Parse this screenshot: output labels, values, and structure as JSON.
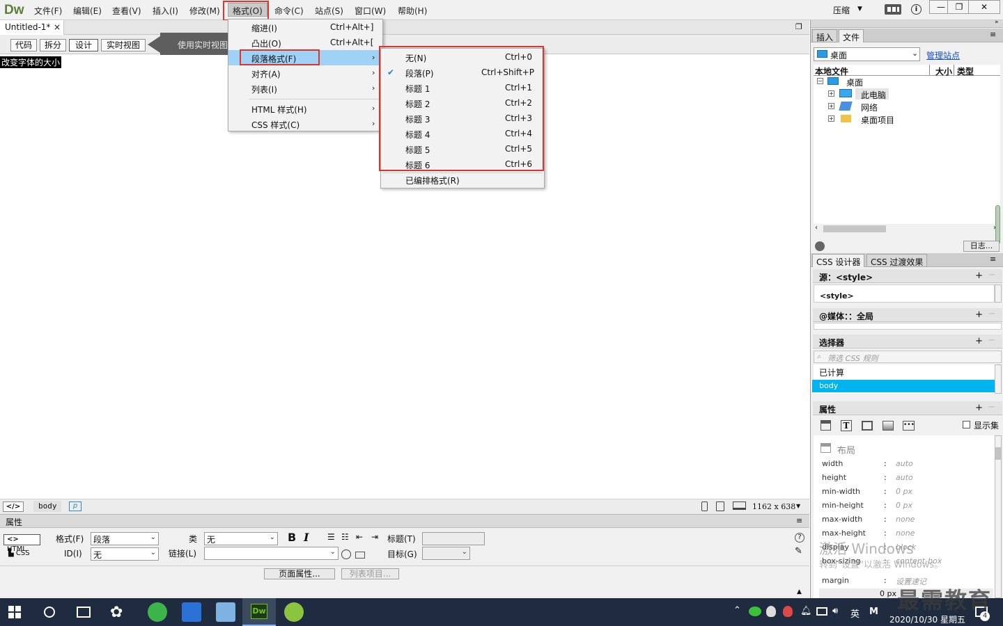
{
  "app": {
    "logo": "Dw"
  },
  "menubar": {
    "items": [
      "文件(F)",
      "编辑(E)",
      "查看(V)",
      "插入(I)",
      "修改(M)",
      "格式(O)",
      "命令(C)",
      "站点(S)",
      "窗口(W)",
      "帮助(H)"
    ],
    "compress": "压缩",
    "window_buttons": {
      "min": "—",
      "restore": "❐",
      "close": "✕"
    }
  },
  "document": {
    "tab_title": "Untitled-1*",
    "tab_close": "×",
    "canvas_text": "改变字体的大小"
  },
  "viewbar": {
    "buttons": [
      "代码",
      "拆分",
      "设计",
      "实时视图"
    ],
    "tooltip": "使用实时视图"
  },
  "format_menu": {
    "items": [
      {
        "label": "缩进(I)",
        "shortcut": "Ctrl+Alt+]"
      },
      {
        "label": "凸出(O)",
        "shortcut": "Ctrl+Alt+["
      },
      {
        "label": "段落格式(F)"
      },
      {
        "label": "对齐(A)"
      },
      {
        "label": "列表(I)"
      },
      {
        "label": "HTML 样式(H)"
      },
      {
        "label": "CSS 样式(C)"
      }
    ],
    "arrow": "›"
  },
  "paragraph_submenu": {
    "items": [
      {
        "label": "无(N)",
        "shortcut": "Ctrl+0"
      },
      {
        "label": "段落(P)",
        "shortcut": "Ctrl+Shift+P"
      },
      {
        "label": "标题 1",
        "shortcut": "Ctrl+1"
      },
      {
        "label": "标题 2",
        "shortcut": "Ctrl+2"
      },
      {
        "label": "标题 3",
        "shortcut": "Ctrl+3"
      },
      {
        "label": "标题 4",
        "shortcut": "Ctrl+4"
      },
      {
        "label": "标题 5",
        "shortcut": "Ctrl+5"
      },
      {
        "label": "标题 6",
        "shortcut": "Ctrl+6"
      },
      {
        "label": "已编排格式(R)"
      }
    ],
    "check": "✔"
  },
  "statusbar": {
    "code_tag": "</>",
    "body_tag": "body",
    "p_tag": "p",
    "size": "1162 x 638"
  },
  "properties": {
    "title": "属性",
    "html_btn": "HTML",
    "css_btn": "CSS",
    "format_label": "格式(F)",
    "format_value": "段落",
    "id_label": "ID(I)",
    "id_value": "无",
    "class_label": "类",
    "class_value": "无",
    "link_label": "链接(L)",
    "link_value": "",
    "bold": "B",
    "italic": "I",
    "title_label": "标题(T)",
    "target_label": "目标(G)",
    "page_props_btn": "页面属性...",
    "list_item_btn": "列表项目..."
  },
  "files_panel": {
    "tabs": [
      "插入",
      "文件"
    ],
    "site": "桌面",
    "manage_link": "管理站点",
    "columns": [
      "本地文件",
      "大小",
      "类型"
    ],
    "tree": [
      "桌面",
      "此电脑",
      "网络",
      "桌面项目"
    ],
    "log_btn": "日志..."
  },
  "css_panel": {
    "tabs": [
      "CSS 设计器",
      "CSS 过渡效果"
    ],
    "source_header": "源：<style>",
    "source_item": "<style>",
    "media_header": "@媒体：：全局",
    "selector_header": "选择器",
    "filter_placeholder": "筛选 CSS 规则",
    "computed": "已计算",
    "body": "body",
    "props_header": "属性",
    "show_set": "显示集",
    "layout_label": "布局",
    "props": [
      {
        "name": "width",
        "value": "auto"
      },
      {
        "name": "height",
        "value": "auto"
      },
      {
        "name": "min-width",
        "value": "0 px"
      },
      {
        "name": "min-height",
        "value": "0 px"
      },
      {
        "name": "max-width",
        "value": "none"
      },
      {
        "name": "max-height",
        "value": "none"
      },
      {
        "name": "display",
        "value": "block"
      },
      {
        "name": "box-sizing",
        "value": "content-box"
      },
      {
        "name": "margin",
        "value": "设置速记"
      }
    ],
    "margin_zero": "0 px"
  },
  "watermarks": {
    "activate_1": "激活 Windows",
    "activate_2": "转到\"设置\"以激活 Windows。",
    "brand": "最需教育"
  },
  "taskbar": {
    "tray_lang": "英",
    "tray_m": "M",
    "date": "2020/10/30 星期五",
    "notify_count": "4"
  },
  "colors": {
    "accent_highlight": "#9fd2f5",
    "red_box": "#e0332b",
    "selection_blue": "#00b4f0"
  }
}
